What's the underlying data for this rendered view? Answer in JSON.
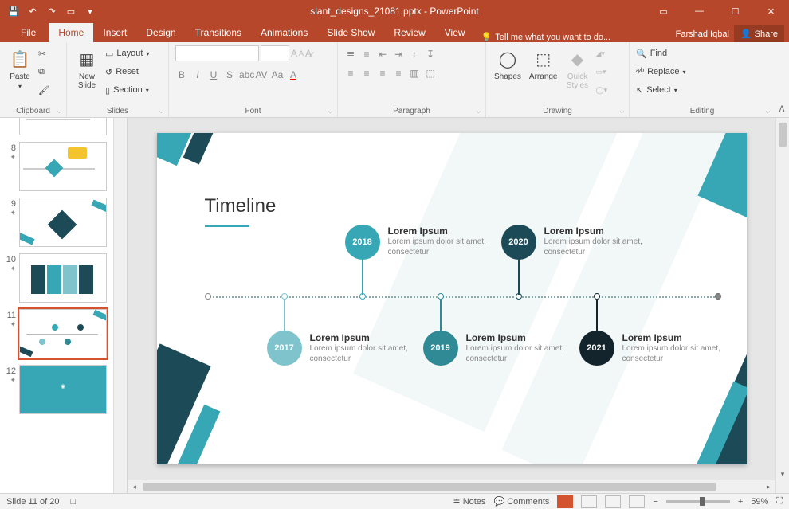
{
  "app": {
    "title": "slant_designs_21081.pptx - PowerPoint",
    "user": "Farshad Iqbal",
    "share": "Share"
  },
  "tabs": {
    "file": "File",
    "home": "Home",
    "insert": "Insert",
    "design": "Design",
    "transitions": "Transitions",
    "animations": "Animations",
    "slideshow": "Slide Show",
    "review": "Review",
    "view": "View",
    "tellme": "Tell me what you want to do..."
  },
  "ribbon": {
    "clipboard": {
      "paste": "Paste",
      "label": "Clipboard"
    },
    "slides": {
      "newslide": "New\nSlide",
      "layout": "Layout",
      "reset": "Reset",
      "section": "Section",
      "label": "Slides"
    },
    "font": {
      "label": "Font"
    },
    "paragraph": {
      "label": "Paragraph"
    },
    "drawing": {
      "shapes": "Shapes",
      "arrange": "Arrange",
      "quick": "Quick\nStyles",
      "label": "Drawing"
    },
    "editing": {
      "find": "Find",
      "replace": "Replace",
      "select": "Select",
      "label": "Editing"
    }
  },
  "thumbs": {
    "n8": "8",
    "n9": "9",
    "n10": "10",
    "n11": "11",
    "n12": "12"
  },
  "slide": {
    "title": "Timeline",
    "items": [
      {
        "year": "2017",
        "h": "Lorem Ipsum",
        "t": "Lorem ipsum dolor sit amet, consectetur"
      },
      {
        "year": "2018",
        "h": "Lorem Ipsum",
        "t": "Lorem ipsum dolor sit amet, consectetur"
      },
      {
        "year": "2019",
        "h": "Lorem Ipsum",
        "t": "Lorem ipsum dolor sit amet, consectetur"
      },
      {
        "year": "2020",
        "h": "Lorem Ipsum",
        "t": "Lorem ipsum dolor sit amet, consectetur"
      },
      {
        "year": "2021",
        "h": "Lorem Ipsum",
        "t": "Lorem ipsum dolor sit amet, consectetur"
      }
    ]
  },
  "status": {
    "slide": "Slide 11 of 20",
    "notes": "Notes",
    "comments": "Comments",
    "zoom": "59%"
  }
}
